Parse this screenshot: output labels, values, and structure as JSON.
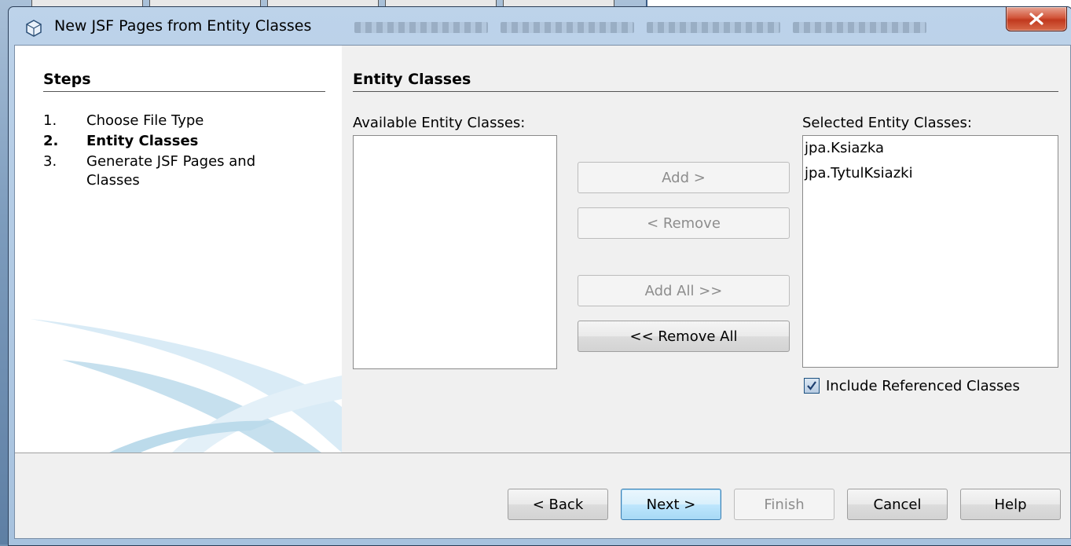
{
  "window": {
    "title": "New JSF Pages from Entity Classes",
    "close_label": "X"
  },
  "steps": {
    "heading": "Steps",
    "items": [
      {
        "num": "1.",
        "label": "Choose File Type"
      },
      {
        "num": "2.",
        "label": "Entity Classes"
      },
      {
        "num": "3.",
        "label": "Generate JSF Pages and Classes"
      }
    ]
  },
  "panel": {
    "heading": "Entity Classes",
    "available_label": "Available Entity Classes:",
    "selected_label": "Selected Entity Classes:",
    "available_items": [],
    "selected_items": [
      "jpa.Ksiazka",
      "jpa.TytulKsiazki"
    ],
    "include_referenced": {
      "label": "Include Referenced Classes",
      "checked": true
    }
  },
  "actions": {
    "add": "Add >",
    "remove": "< Remove",
    "add_all": "Add All >>",
    "remove_all": "<< Remove All"
  },
  "footer": {
    "back": "< Back",
    "next": "Next >",
    "finish": "Finish",
    "cancel": "Cancel",
    "help": "Help"
  }
}
